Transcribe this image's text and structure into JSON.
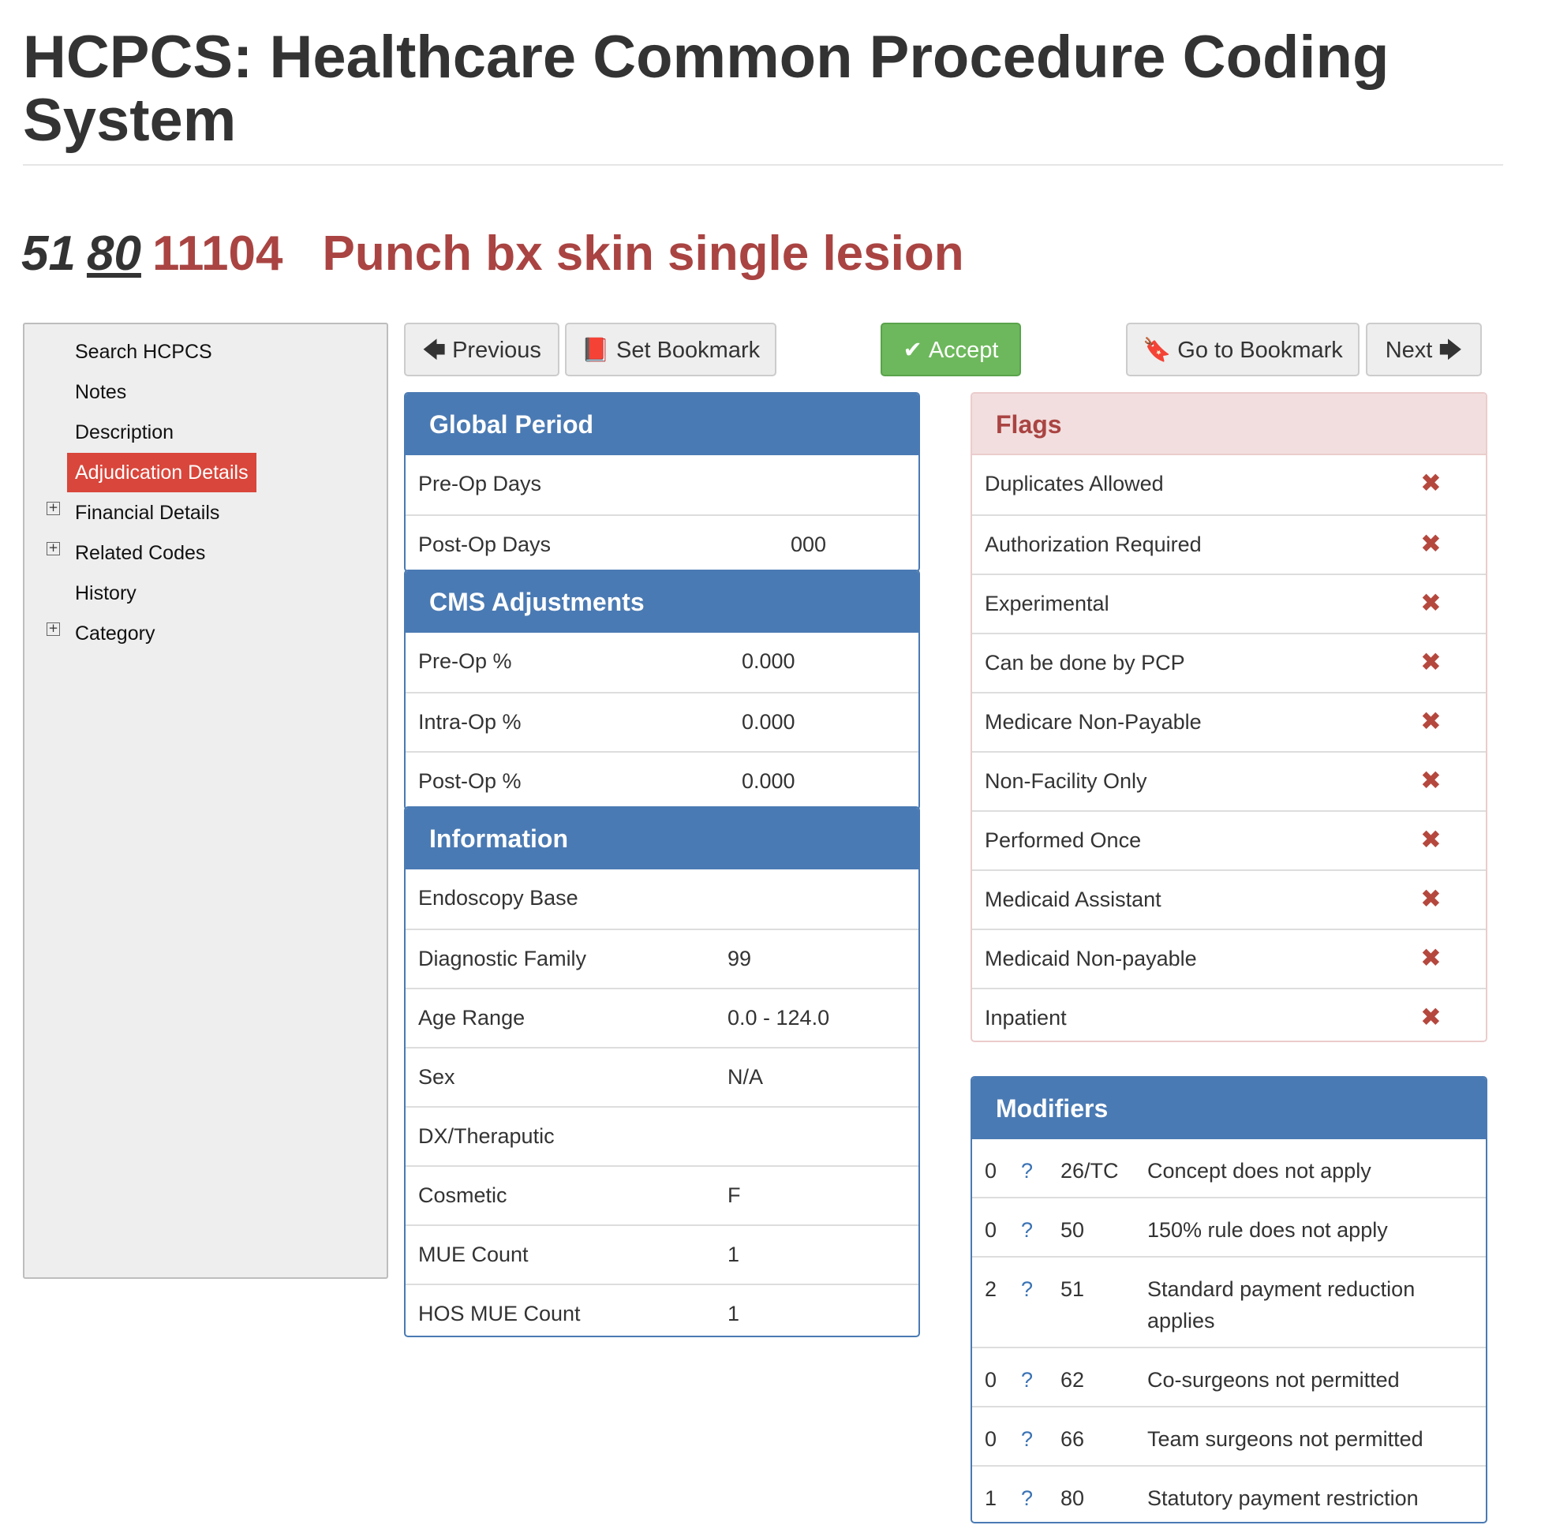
{
  "page": {
    "title": "HCPCS: Healthcare Common Procedure Coding System"
  },
  "code": {
    "modifier_1": "51",
    "modifier_2": "80",
    "number": "11104",
    "description": "Punch bx skin single lesion"
  },
  "sidebar": {
    "items": [
      {
        "label": "Search HCPCS",
        "expandable": false,
        "active": false
      },
      {
        "label": "Notes",
        "expandable": false,
        "active": false
      },
      {
        "label": "Description",
        "expandable": false,
        "active": false
      },
      {
        "label": "Adjudication Details",
        "expandable": false,
        "active": true
      },
      {
        "label": "Financial Details",
        "expandable": true,
        "active": false
      },
      {
        "label": "Related Codes",
        "expandable": true,
        "active": false
      },
      {
        "label": "History",
        "expandable": false,
        "active": false
      },
      {
        "label": "Category",
        "expandable": true,
        "active": false
      }
    ],
    "expand_glyph": "+"
  },
  "toolbar": {
    "previous": {
      "label": "Previous",
      "icon": "arrow-left-icon",
      "glyph": "🡄"
    },
    "set_bookmark": {
      "label": "Set Bookmark",
      "icon": "book-icon",
      "glyph": "📕"
    },
    "accept": {
      "label": "Accept",
      "icon": "check-icon",
      "glyph": "✔"
    },
    "go_to_bookmark": {
      "label": "Go to Bookmark",
      "icon": "bookmark-icon",
      "glyph": "🔖"
    },
    "next": {
      "label": "Next",
      "icon": "arrow-right-icon",
      "glyph": "🡆"
    }
  },
  "global_period": {
    "title": "Global Period",
    "rows": [
      {
        "label": "Pre-Op Days",
        "value": ""
      },
      {
        "label": "Post-Op Days",
        "value": "000"
      }
    ]
  },
  "cms_adjustments": {
    "title": "CMS Adjustments",
    "rows": [
      {
        "label": "Pre-Op %",
        "value": "0.000"
      },
      {
        "label": "Intra-Op %",
        "value": "0.000"
      },
      {
        "label": "Post-Op %",
        "value": "0.000"
      }
    ]
  },
  "information": {
    "title": "Information",
    "rows": [
      {
        "label": "Endoscopy Base",
        "value": ""
      },
      {
        "label": "Diagnostic Family",
        "value": "99"
      },
      {
        "label": "Age Range",
        "value": "0.0 - 124.0"
      },
      {
        "label": "Sex",
        "value": "N/A"
      },
      {
        "label": "DX/Theraputic",
        "value": ""
      },
      {
        "label": "Cosmetic",
        "value": "F"
      },
      {
        "label": "MUE Count",
        "value": "1"
      },
      {
        "label": "HOS MUE Count",
        "value": "1"
      }
    ]
  },
  "flags": {
    "title": "Flags",
    "icon": "x-mark-icon",
    "mark_glyph": "✖",
    "rows": [
      {
        "label": "Duplicates Allowed"
      },
      {
        "label": "Authorization Required"
      },
      {
        "label": "Experimental"
      },
      {
        "label": "Can be done by PCP"
      },
      {
        "label": "Medicare Non-Payable"
      },
      {
        "label": "Non-Facility Only"
      },
      {
        "label": "Performed Once"
      },
      {
        "label": "Medicaid Assistant"
      },
      {
        "label": "Medicaid Non-payable"
      },
      {
        "label": "Inpatient"
      }
    ]
  },
  "modifiers": {
    "title": "Modifiers",
    "help_glyph": "?",
    "rows": [
      {
        "indicator": "0",
        "code": "26/TC",
        "description": "Concept does not apply"
      },
      {
        "indicator": "0",
        "code": "50",
        "description": "150% rule does not apply"
      },
      {
        "indicator": "2",
        "code": "51",
        "description": "Standard payment reduction applies"
      },
      {
        "indicator": "0",
        "code": "62",
        "description": "Co-surgeons not permitted"
      },
      {
        "indicator": "0",
        "code": "66",
        "description": "Team surgeons not permitted"
      },
      {
        "indicator": "1",
        "code": "80",
        "description": "Statutory payment restriction"
      }
    ]
  },
  "colors": {
    "accent_red": "#a94442",
    "panel_blue": "#4a7ab3",
    "active_item": "#d9463b",
    "accept_green": "#6db85c"
  }
}
